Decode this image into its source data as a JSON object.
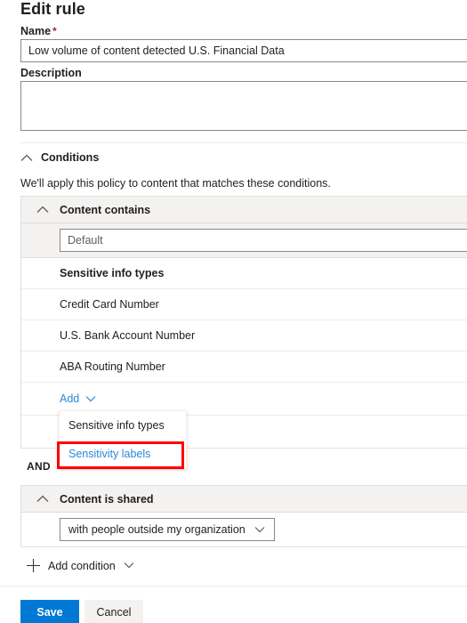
{
  "page": {
    "title": "Edit rule"
  },
  "form": {
    "name_label": "Name",
    "name_required_mark": "*",
    "name_value": "Low volume of content detected U.S. Financial Data",
    "name_placeholder": "",
    "description_label": "Description",
    "description_value": "",
    "description_placeholder": ""
  },
  "conditions": {
    "header": "Conditions",
    "subtitle": "We'll apply this policy to content that matches these conditions.",
    "operator_label": "AND",
    "content_contains": {
      "title": "Content contains",
      "group_value": "Default",
      "group_placeholder": "Default",
      "table_header": "Sensitive info types",
      "items": [
        "Credit Card Number",
        "U.S. Bank Account Number",
        "ABA Routing Number"
      ],
      "add_label": "Add",
      "menu": {
        "items": [
          {
            "label": "Sensitive info types",
            "highlighted": false
          },
          {
            "label": "Sensitivity labels",
            "highlighted": true
          }
        ]
      }
    },
    "content_is_shared": {
      "title": "Content is shared",
      "selected_option": "with people outside my organization"
    },
    "add_condition_label": "Add condition"
  },
  "footer": {
    "save_label": "Save",
    "cancel_label": "Cancel"
  },
  "colors": {
    "accent": "#0078d4",
    "link": "#2b88d8",
    "required": "#a4262c",
    "highlight_box": "#ff0000",
    "row_gray": "#f3f2f1",
    "border": "#e1dfdd"
  }
}
